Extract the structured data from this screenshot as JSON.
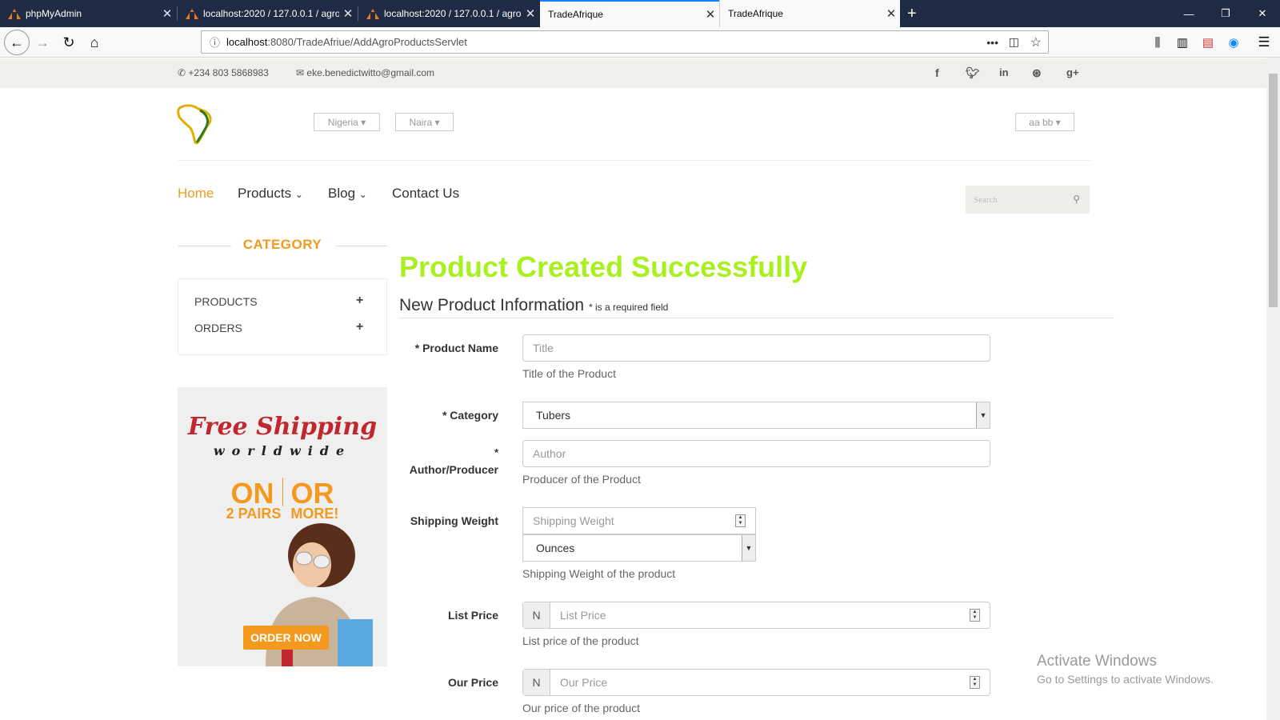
{
  "browser": {
    "tabs": [
      {
        "title": "phpMyAdmin"
      },
      {
        "title": "localhost:2020 / 127.0.0.1 / agro"
      },
      {
        "title": "localhost:2020 / 127.0.0.1 / agro"
      },
      {
        "title": "TradeAfrique"
      },
      {
        "title": "TradeAfrique"
      }
    ],
    "new_tab": "+",
    "url_host": "localhost",
    "url_rest": ":8080/TradeAfriue/AddAgroProductsServlet"
  },
  "topbar": {
    "phone": "+234 803 5868983",
    "email": "eke.benedictwitto@gmail.com"
  },
  "header": {
    "country": "Nigeria",
    "currency": "Naira",
    "user": "aa bb"
  },
  "nav": {
    "home": "Home",
    "products": "Products",
    "blog": "Blog",
    "contact": "Contact Us",
    "search_placeholder": "Search"
  },
  "sidebar": {
    "title": "CATEGORY",
    "items": [
      {
        "label": "PRODUCTS"
      },
      {
        "label": "ORDERS"
      }
    ]
  },
  "banner": {
    "line1": "Free Shipping",
    "line2": "worldwide",
    "on": "ON",
    "or": "OR",
    "pairs": "2 PAIRS",
    "more": "MORE!",
    "button": "ORDER NOW"
  },
  "form": {
    "success": "Product Created Successfully",
    "heading": "New Product Information",
    "required_note": "* is a required field",
    "product_name_label": "* Product Name",
    "product_name_placeholder": "Title",
    "product_name_help": "Title of the Product",
    "category_label": "* Category",
    "category_value": "Tubers",
    "author_label_star": "*",
    "author_label": "Author/Producer",
    "author_placeholder": "Author",
    "author_help": "Producer of the Product",
    "weight_label": "Shipping Weight",
    "weight_placeholder": "Shipping Weight",
    "weight_unit": "Ounces",
    "weight_help": "Shipping Weight of the product",
    "list_price_label": "List Price",
    "list_price_addon": "N",
    "list_price_placeholder": "List Price",
    "list_price_help": "List price of the product",
    "our_price_label": "Our Price",
    "our_price_addon": "N",
    "our_price_placeholder": "Our Price",
    "our_price_help": "Our price of the product"
  },
  "watermark": {
    "line1": "Activate Windows",
    "line2": "Go to Settings to activate Windows."
  }
}
